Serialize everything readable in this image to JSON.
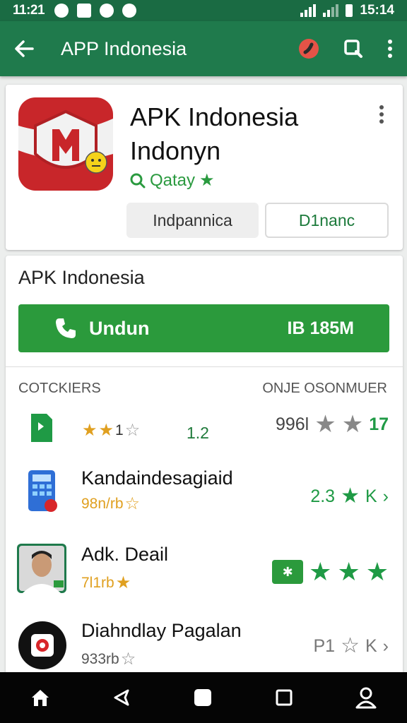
{
  "status_bar": {
    "time_left": "11:21",
    "time_right": "15:14"
  },
  "toolbar": {
    "title": "APP Indonesia",
    "icons": [
      "back-arrow-icon",
      "record-icon",
      "search-icon",
      "more-vert-icon"
    ]
  },
  "app": {
    "title": "APK Indonesia Indonyn",
    "rating_text": "Qatay",
    "button_primary": "Indpannica",
    "button_secondary": "D1nanc"
  },
  "section": {
    "title": "APK Indonesia",
    "install_label": "Undun",
    "install_size": "IB 185M",
    "col_left": "COTCKIERS",
    "col_right": "ONJE OSONMUER"
  },
  "rows": [
    {
      "name": "",
      "sub": "1",
      "mid": "1.2",
      "right_text": "996l",
      "right_suffix": "17",
      "stars": 2
    },
    {
      "name": "Kandaindesagiaid",
      "sub": "98n/rb",
      "right_text": "2.3",
      "right_suffix": "K",
      "stars": 0
    },
    {
      "name": "Adk. Deail",
      "sub": "7l1rb",
      "right_text": "",
      "right_suffix": "",
      "stars": 0
    },
    {
      "name": "Diahndlay Pagalan",
      "sub": "933rb",
      "right_text": "P1",
      "right_suffix": "K",
      "stars": 0
    }
  ],
  "colors": {
    "status": "#1a6b43",
    "toolbar": "#1f7a4c",
    "green": "#2b9a3c",
    "star_gold": "#e0a020"
  }
}
